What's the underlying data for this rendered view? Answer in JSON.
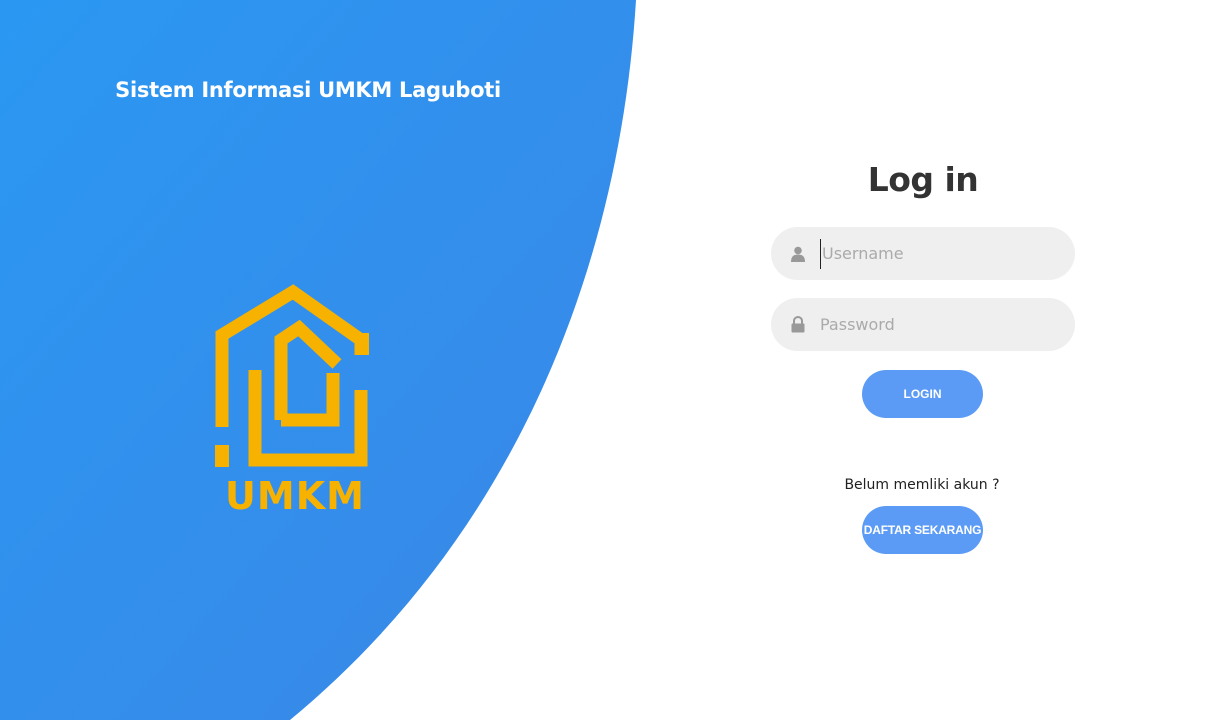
{
  "colors": {
    "panel_gradient_start": "#2a98f2",
    "panel_gradient_end": "#3b87e8",
    "logo_accent": "#f7b200",
    "button_bg": "#5b9bf5",
    "field_bg": "#efefef"
  },
  "header": {
    "site_title": "Sistem Informasi UMKM Laguboti"
  },
  "logo": {
    "text": "UMKM",
    "icon": "house-logo-icon"
  },
  "login": {
    "title": "Log in",
    "username": {
      "placeholder": "Username",
      "value": "",
      "icon": "user-icon"
    },
    "password": {
      "placeholder": "Password",
      "value": "",
      "icon": "lock-icon"
    },
    "login_button": "LOGIN"
  },
  "register": {
    "prompt": "Belum memliki akun ?",
    "button": "DAFTAR SEKARANG"
  }
}
